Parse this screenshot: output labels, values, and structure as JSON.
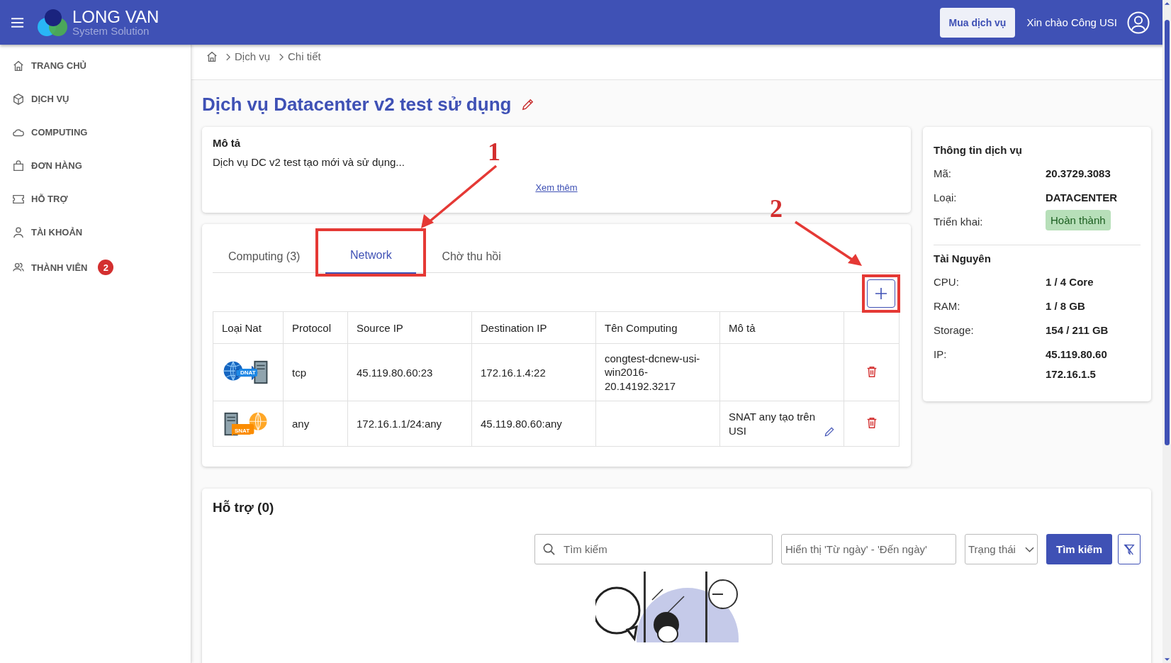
{
  "header": {
    "logo_title": "LONG VAN",
    "logo_subtitle": "System Solution",
    "buy_button": "Mua dịch vụ",
    "greeting": "Xin chào Công USI"
  },
  "sidebar": {
    "items": [
      {
        "label": "TRANG CHỦ",
        "kind": "home"
      },
      {
        "label": "DỊCH VỤ",
        "kind": "cube"
      },
      {
        "label": "COMPUTING",
        "kind": "cloud"
      },
      {
        "label": "ĐƠN HÀNG",
        "kind": "bag"
      },
      {
        "label": "HỖ TRỢ",
        "kind": "ticket"
      },
      {
        "label": "TÀI KHOẢN",
        "kind": "user"
      },
      {
        "label": "THÀNH VIÊN",
        "kind": "users",
        "badge": "2"
      }
    ]
  },
  "breadcrumb": [
    "Dịch vụ",
    "Chi tiết"
  ],
  "title": "Dịch vụ Datacenter v2 test sử dụng",
  "description": {
    "heading": "Mô tả",
    "text": "Dịch vụ DC v2 test tạo mới và sử dụng...",
    "more_link": "Xem thêm"
  },
  "tabs": [
    {
      "label": "Computing (3)",
      "selected": false,
      "highlighted": false
    },
    {
      "label": "Network",
      "selected": true,
      "highlighted": true
    },
    {
      "label": "Chờ thu hồi",
      "selected": false,
      "highlighted": false
    }
  ],
  "add_button": {
    "highlighted": true
  },
  "table": {
    "columns": [
      "Loại Nat",
      "Protocol",
      "Source IP",
      "Destination IP",
      "Tên Computing",
      "Mô tả"
    ],
    "rows": [
      {
        "nat": "DNAT",
        "kind": "dnat",
        "protocol": "tcp",
        "source_ip": "45.119.80.60:23",
        "destination_ip": "172.16.1.4:22",
        "computing": "congtest-dcnew-usi-win2016-20.14192.3217",
        "description": ""
      },
      {
        "nat": "SNAT",
        "kind": "snat",
        "protocol": "any",
        "source_ip": "172.16.1.1/24:any",
        "destination_ip": "45.119.80.60:any",
        "computing": "",
        "description": "SNAT any tạo trên USI"
      }
    ]
  },
  "service_info": {
    "title": "Thông tin dịch vụ",
    "rows": [
      {
        "label": "Mã:",
        "kind": "text",
        "values": [
          "20.3729.3083"
        ]
      },
      {
        "label": "Loại:",
        "kind": "text",
        "values": [
          "DATACENTER"
        ]
      },
      {
        "label": "Triển khai:",
        "kind": "badge",
        "values": [
          "Hoàn thành"
        ]
      }
    ]
  },
  "resources": {
    "title": "Tài Nguyên",
    "rows": [
      {
        "label": "CPU:",
        "kind": "text",
        "values": [
          "1 / 4 Core"
        ]
      },
      {
        "label": "RAM:",
        "kind": "text",
        "values": [
          "1 / 8 GB"
        ]
      },
      {
        "label": "Storage:",
        "kind": "text",
        "values": [
          "154 / 211 GB"
        ]
      },
      {
        "label": "IP:",
        "kind": "text",
        "values": [
          "45.119.80.60",
          "172.16.1.5"
        ]
      }
    ]
  },
  "support": {
    "title": "Hỗ trợ (0)",
    "search_placeholder": "Tìm kiếm",
    "date_placeholder": "Hiển thị 'Từ ngày' - 'Đến ngày'",
    "status_placeholder": "Trạng thái",
    "search_button": "Tìm kiếm"
  },
  "annotations": [
    {
      "label": "1"
    },
    {
      "label": "2"
    }
  ]
}
